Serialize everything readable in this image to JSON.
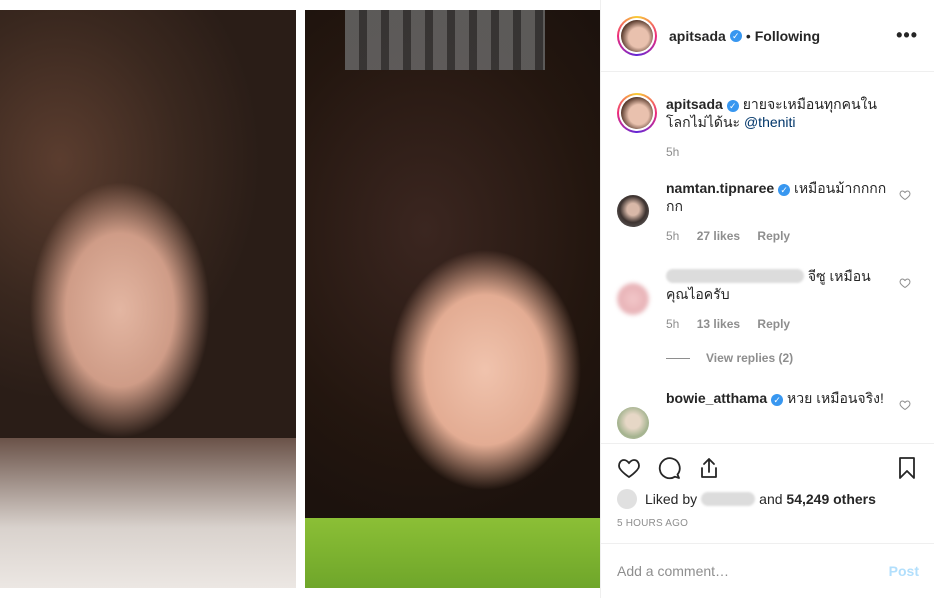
{
  "post": {
    "author": "apitsada",
    "follow_status": "Following",
    "more_label": "•••",
    "dot": "•"
  },
  "caption": {
    "user": "apitsada",
    "text": "ยายจะเหมือนทุกคนในโลกไม่ได้นะ",
    "mention": "@theniti",
    "time": "5h"
  },
  "comments": [
    {
      "user": "namtan.tipnaree",
      "text": "เหมือนม้ากกกกกก",
      "time": "5h",
      "likes": "27 likes",
      "reply": "Reply"
    },
    {
      "user": "",
      "text": "จีซู เหมือนคุณไอครับ",
      "time": "5h",
      "likes": "13 likes",
      "reply": "Reply",
      "view_replies": "View replies (2)"
    },
    {
      "user": "bowie_atthama",
      "text": "หวย เหมือนจริง!",
      "time": "",
      "likes": "",
      "reply": ""
    }
  ],
  "likes": {
    "prefix": "Liked by",
    "joiner": "and",
    "others": "54,249 others"
  },
  "timestamp": "5 HOURS AGO",
  "add_comment": {
    "placeholder": "Add a comment…",
    "post_label": "Post"
  },
  "icons": [
    "heart-icon",
    "comment-icon",
    "share-icon",
    "bookmark-icon",
    "verified-icon",
    "more-icon"
  ],
  "colors": {
    "verified": "#3897f0",
    "post_disabled": "#b2dffc",
    "muted": "#8e8e8e"
  }
}
